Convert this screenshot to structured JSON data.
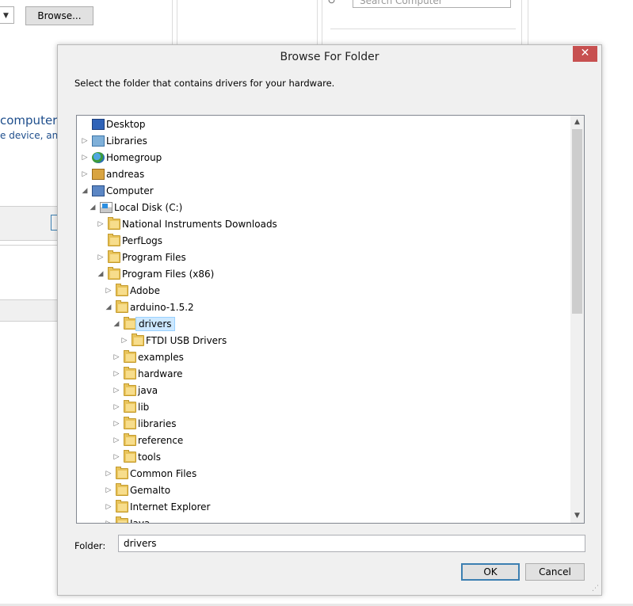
{
  "background": {
    "browse_label": "Browse...",
    "search_placeholder": "Search Computer",
    "computer_heading": "computer",
    "device_text": "e device, and a"
  },
  "dialog": {
    "title": "Browse For Folder",
    "close_glyph": "✕",
    "instruction": "Select the folder that contains drivers for your hardware.",
    "folder_label": "Folder:",
    "folder_value": "drivers",
    "ok_label": "OK",
    "cancel_label": "Cancel"
  },
  "tree": [
    {
      "label": "Desktop",
      "icon": "desktop-icon",
      "expander": "none",
      "level": 0
    },
    {
      "label": "Libraries",
      "icon": "libraries-icon",
      "expander": "collapsed",
      "level": 0
    },
    {
      "label": "Homegroup",
      "icon": "homegroup-icon",
      "expander": "collapsed",
      "level": 0
    },
    {
      "label": "andreas",
      "icon": "user-folder-icon",
      "expander": "collapsed",
      "level": 0
    },
    {
      "label": "Computer",
      "icon": "computer-icon",
      "expander": "expanded",
      "level": 0
    },
    {
      "label": "Local Disk (C:)",
      "icon": "local-disk-icon",
      "expander": "expanded",
      "level": 1
    },
    {
      "label": "National Instruments Downloads",
      "icon": "folder-icon",
      "expander": "collapsed",
      "level": 2
    },
    {
      "label": "PerfLogs",
      "icon": "folder-icon",
      "expander": "none",
      "level": 2
    },
    {
      "label": "Program Files",
      "icon": "folder-icon",
      "expander": "collapsed",
      "level": 2
    },
    {
      "label": "Program Files (x86)",
      "icon": "folder-icon",
      "expander": "expanded",
      "level": 2
    },
    {
      "label": "Adobe",
      "icon": "folder-icon",
      "expander": "collapsed",
      "level": 3
    },
    {
      "label": "arduino-1.5.2",
      "icon": "folder-icon",
      "expander": "expanded",
      "level": 3
    },
    {
      "label": "drivers",
      "icon": "folder-icon",
      "expander": "expanded",
      "level": 4,
      "selected": true
    },
    {
      "label": "FTDI USB Drivers",
      "icon": "folder-icon",
      "expander": "collapsed",
      "level": 5
    },
    {
      "label": "examples",
      "icon": "folder-icon",
      "expander": "collapsed",
      "level": 4
    },
    {
      "label": "hardware",
      "icon": "folder-icon",
      "expander": "collapsed",
      "level": 4
    },
    {
      "label": "java",
      "icon": "folder-icon",
      "expander": "collapsed",
      "level": 4
    },
    {
      "label": "lib",
      "icon": "folder-icon",
      "expander": "collapsed",
      "level": 4
    },
    {
      "label": "libraries",
      "icon": "folder-icon",
      "expander": "collapsed",
      "level": 4
    },
    {
      "label": "reference",
      "icon": "folder-icon",
      "expander": "collapsed",
      "level": 4
    },
    {
      "label": "tools",
      "icon": "folder-icon",
      "expander": "collapsed",
      "level": 4
    },
    {
      "label": "Common Files",
      "icon": "folder-icon",
      "expander": "collapsed",
      "level": 3
    },
    {
      "label": "Gemalto",
      "icon": "folder-icon",
      "expander": "collapsed",
      "level": 3
    },
    {
      "label": "Internet Explorer",
      "icon": "folder-icon",
      "expander": "collapsed",
      "level": 3
    },
    {
      "label": "Java",
      "icon": "folder-icon",
      "expander": "collapsed",
      "level": 3
    }
  ],
  "colors": {
    "close_red": "#c75050",
    "selection_fill": "#cce8ff",
    "selection_border": "#99d1ff",
    "folder_yellow": "#e8c35a"
  }
}
